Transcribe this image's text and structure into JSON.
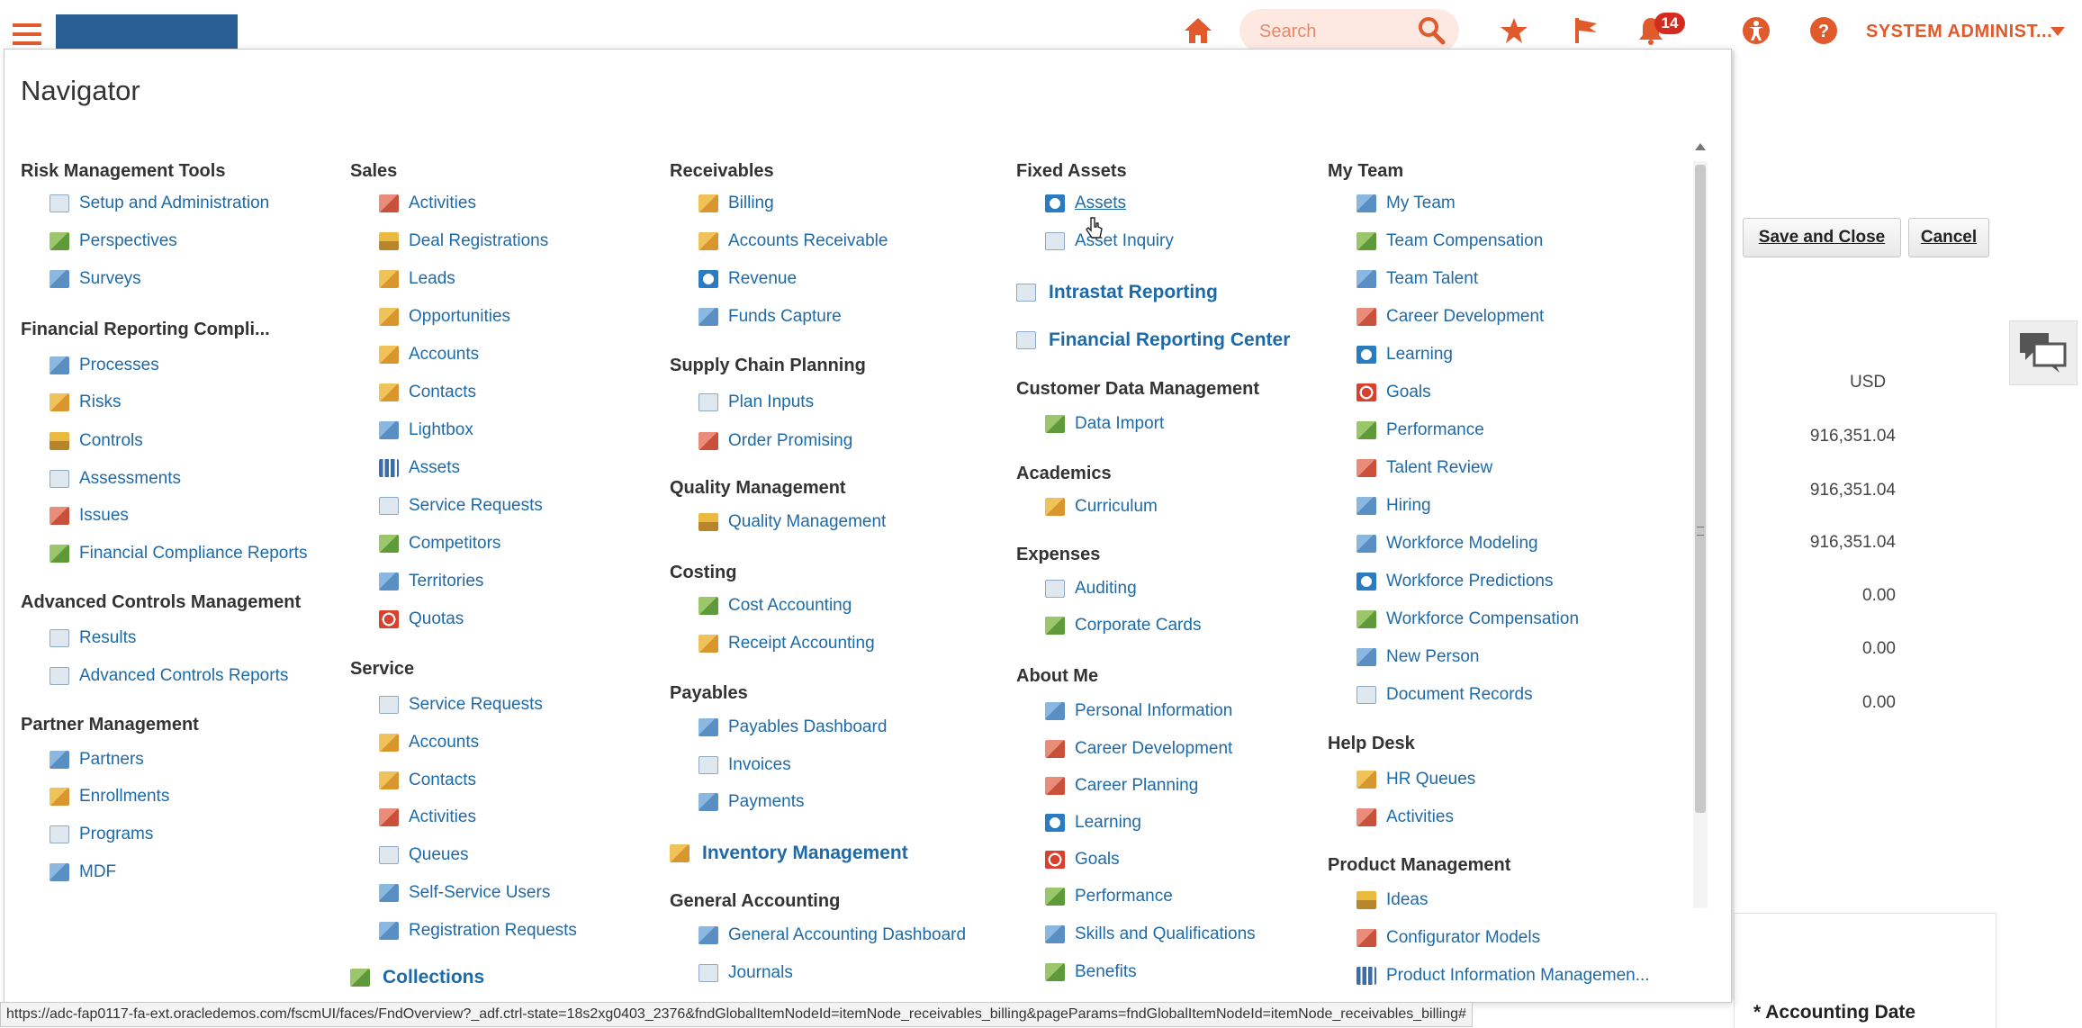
{
  "topbar": {
    "search_placeholder": "Search",
    "notification_count": "14",
    "user_name": "SYSTEM ADMINIST...",
    "accent_color": "#e05a2b",
    "brand_color": "#2a5f95"
  },
  "background": {
    "save_close_label": "Save and Close",
    "cancel_label": "Cancel",
    "currency": "USD",
    "amounts": [
      "916,351.04",
      "916,351.04",
      "916,351.04",
      "0.00",
      "0.00",
      "0.00"
    ],
    "accounting_date_label": "Accounting Date",
    "required_marker": "*"
  },
  "navigator": {
    "title": "Navigator",
    "col1": {
      "risk_header": "Risk Management Tools",
      "risk_items": [
        "Setup and Administration",
        "Perspectives",
        "Surveys"
      ],
      "frc_header": "Financial Reporting Compli...",
      "frc_items": [
        "Processes",
        "Risks",
        "Controls",
        "Assessments",
        "Issues",
        "Financial Compliance Reports"
      ],
      "acm_header": "Advanced Controls Management",
      "acm_items": [
        "Results",
        "Advanced Controls Reports"
      ],
      "pm_header": "Partner Management",
      "pm_items": [
        "Partners",
        "Enrollments",
        "Programs",
        "MDF"
      ]
    },
    "col2": {
      "sales_header": "Sales",
      "sales_items": [
        "Activities",
        "Deal Registrations",
        "Leads",
        "Opportunities",
        "Accounts",
        "Contacts",
        "Lightbox",
        "Assets",
        "Service Requests",
        "Competitors",
        "Territories",
        "Quotas"
      ],
      "service_header": "Service",
      "service_items": [
        "Service Requests",
        "Accounts",
        "Contacts",
        "Activities",
        "Queues",
        "Self-Service Users",
        "Registration Requests"
      ],
      "collections": "Collections"
    },
    "col3": {
      "recv_header": "Receivables",
      "recv_items": [
        "Billing",
        "Accounts Receivable",
        "Revenue",
        "Funds Capture"
      ],
      "scp_header": "Supply Chain Planning",
      "scp_items": [
        "Plan Inputs",
        "Order Promising"
      ],
      "qm_header": "Quality Management",
      "qm_items": [
        "Quality Management"
      ],
      "costing_header": "Costing",
      "costing_items": [
        "Cost Accounting",
        "Receipt Accounting"
      ],
      "payables_header": "Payables",
      "payables_items": [
        "Payables Dashboard",
        "Invoices",
        "Payments"
      ],
      "inventory": "Inventory Management",
      "ga_header": "General Accounting",
      "ga_items": [
        "General Accounting Dashboard",
        "Journals"
      ]
    },
    "col4": {
      "fa_header": "Fixed Assets",
      "fa_items": [
        "Assets",
        "Asset Inquiry"
      ],
      "intrastat": "Intrastat Reporting",
      "frc": "Financial Reporting Center",
      "cdm_header": "Customer Data Management",
      "cdm_items": [
        "Data Import"
      ],
      "academics_header": "Academics",
      "academics_items": [
        "Curriculum"
      ],
      "expenses_header": "Expenses",
      "expenses_items": [
        "Auditing",
        "Corporate Cards"
      ],
      "aboutme_header": "About Me",
      "aboutme_items": [
        "Personal Information",
        "Career Development",
        "Career Planning",
        "Learning",
        "Goals",
        "Performance",
        "Skills and Qualifications",
        "Benefits"
      ]
    },
    "col5": {
      "myteam_header": "My Team",
      "myteam_items": [
        "My Team",
        "Team Compensation",
        "Team Talent",
        "Career Development",
        "Learning",
        "Goals",
        "Performance",
        "Talent Review",
        "Hiring",
        "Workforce Modeling",
        "Workforce Predictions",
        "Workforce Compensation",
        "New Person",
        "Document Records"
      ],
      "helpdesk_header": "Help Desk",
      "helpdesk_items": [
        "HR Queues",
        "Activities"
      ],
      "prodmgmt_header": "Product Management",
      "prodmgmt_items": [
        "Ideas",
        "Configurator Models",
        "Product Information Managemen..."
      ]
    }
  },
  "status_url": "https://adc-fap0117-fa-ext.oracledemos.com/fscmUI/faces/FndOverview?_adf.ctrl-state=18s2xg0403_2376&fndGlobalItemNodeId=itemNode_receivables_billing&pageParams=fndGlobalItemNodeId=itemNode_receivables_billing#"
}
